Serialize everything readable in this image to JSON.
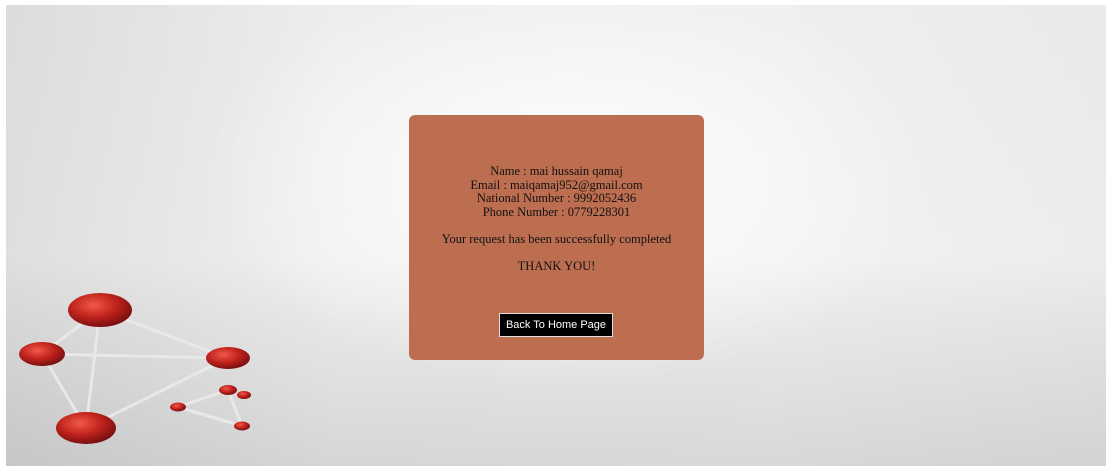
{
  "confirmation": {
    "name": "Name : mai hussain qamaj",
    "email": "Email : maiqamaj952@gmail.com",
    "national_number": "National Number : 9992052436",
    "phone_number": "Phone Number : 0779228301",
    "message": "Your request has been successfully completed",
    "thanks": "THANK YOU!",
    "home_button_label": "Back To Home Page"
  },
  "colors": {
    "card_background": "#bd6e50",
    "button_background": "#000000",
    "button_text": "#ffffff",
    "molecule_red": "#c0221c"
  },
  "decoration": {
    "background_icon": "molecule-icon"
  }
}
